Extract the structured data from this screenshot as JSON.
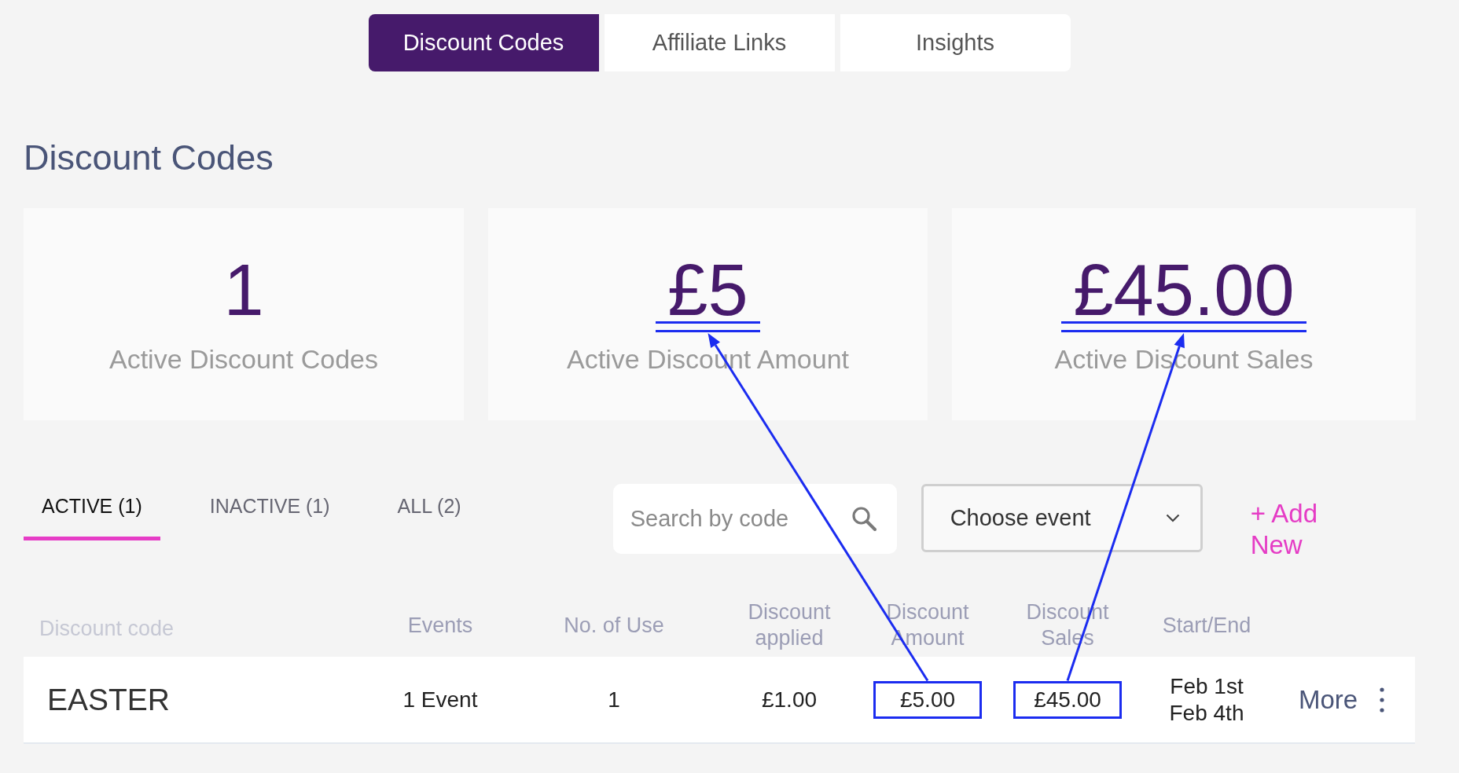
{
  "tabs": [
    {
      "label": "Discount Codes",
      "selected": true
    },
    {
      "label": "Affiliate Links",
      "selected": false
    },
    {
      "label": "Insights",
      "selected": false
    }
  ],
  "heading": "Discount Codes",
  "stats": [
    {
      "value": "1",
      "label": "Active Discount Codes",
      "underlined": false
    },
    {
      "value": "£5",
      "label": "Active Discount Amount",
      "underlined": true
    },
    {
      "value": "£45.00",
      "label": "Active Discount Sales",
      "underlined": true
    }
  ],
  "filters": [
    {
      "label": "ACTIVE (1)",
      "selected": true
    },
    {
      "label": "INACTIVE (1)",
      "selected": false
    },
    {
      "label": "ALL (2)",
      "selected": false
    }
  ],
  "search": {
    "placeholder": "Search by code"
  },
  "event_select": {
    "value": "Choose event"
  },
  "add_new": "+ Add New",
  "table": {
    "columns": [
      "Discount code",
      "Events",
      "No. of Use",
      "Discount applied",
      "Discount Amount",
      "Discount Sales",
      "Start/End"
    ],
    "rows": [
      {
        "cells": [
          {
            "kind": "code",
            "text": "EASTER",
            "boxed": false
          },
          {
            "kind": "text",
            "text": "1 Event",
            "boxed": false
          },
          {
            "kind": "text",
            "text": "1",
            "boxed": false
          },
          {
            "kind": "text",
            "text": "£1.00",
            "boxed": false
          },
          {
            "kind": "text",
            "text": "£5.00",
            "boxed": true
          },
          {
            "kind": "text",
            "text": "£45.00",
            "boxed": true
          },
          {
            "kind": "dates",
            "start": "Feb 1st",
            "end": "Feb 4th",
            "boxed": false
          }
        ],
        "action": "More"
      }
    ]
  }
}
